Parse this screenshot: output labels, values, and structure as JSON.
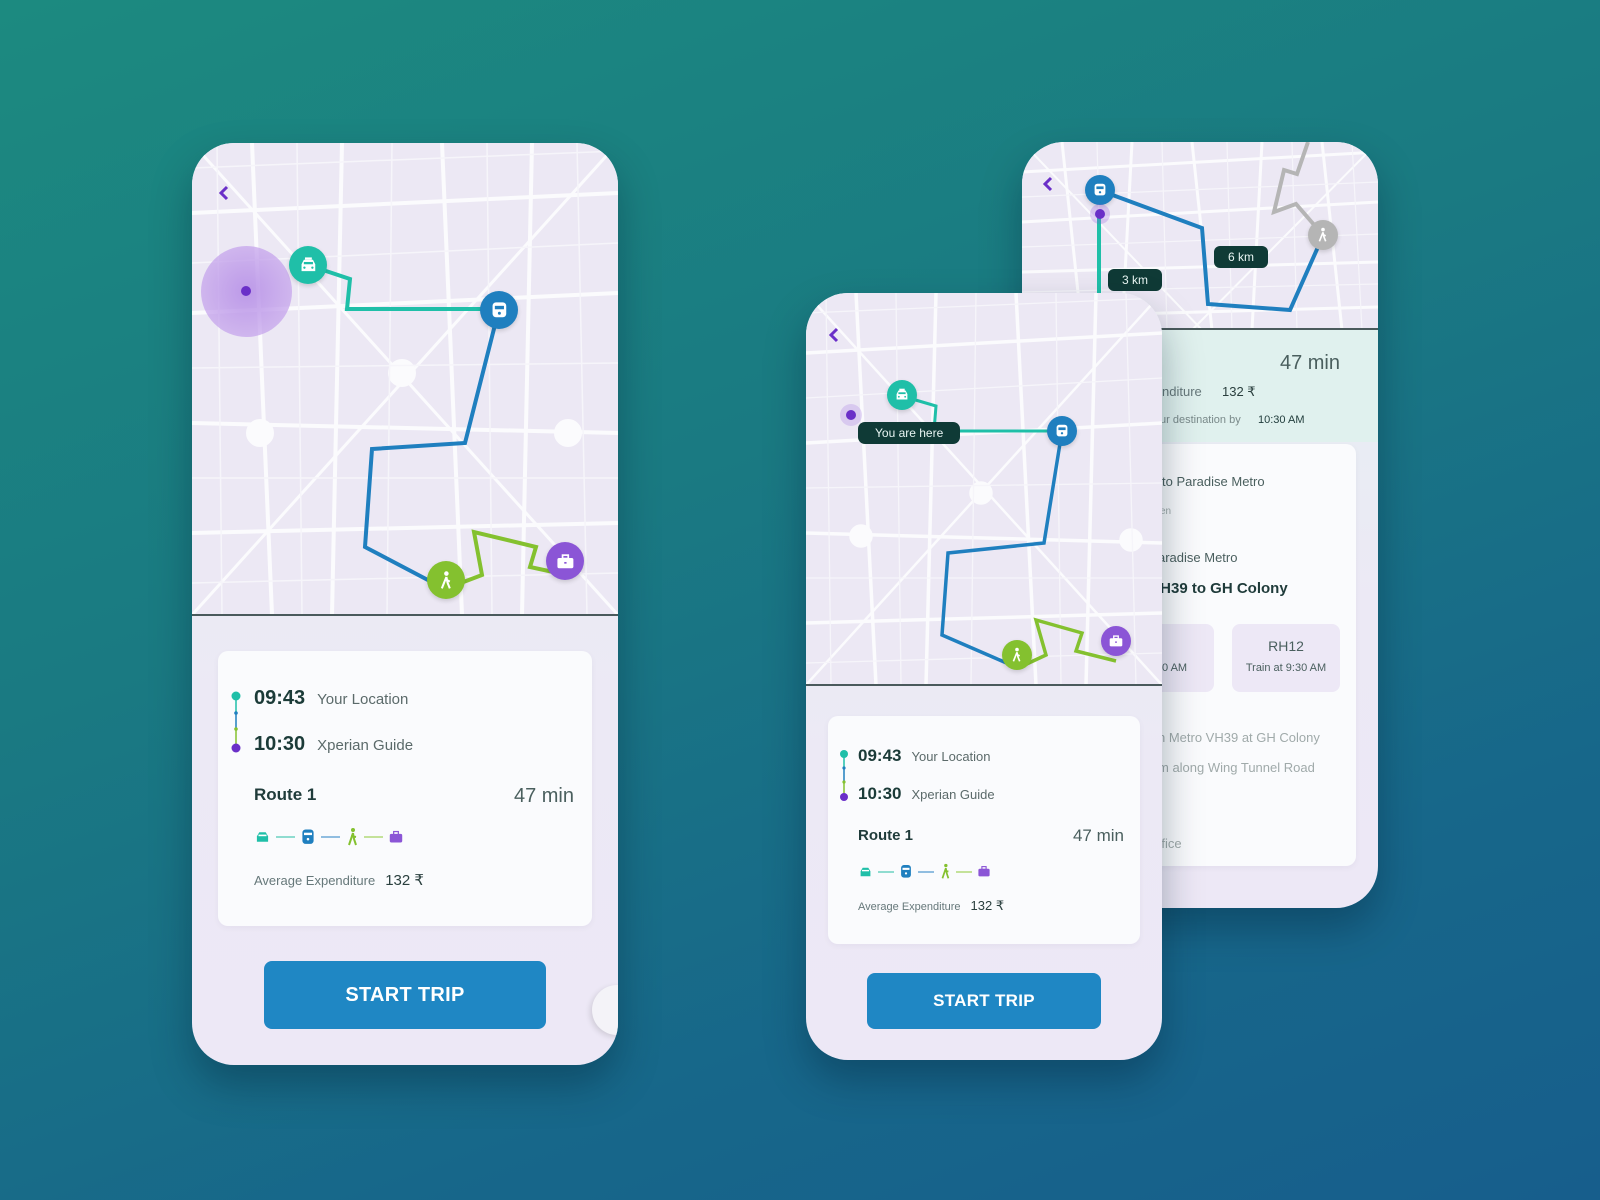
{
  "colors": {
    "taxi": "#1fbfa8",
    "metro": "#1f7fbf",
    "walk": "#84c12f",
    "office": "#8b55d6",
    "accent_purple": "#6a2fc8",
    "button": "#1f87c4",
    "tag_bg": "#0f3a36",
    "inactive": "#b5b5b5"
  },
  "screen_left": {
    "back_icon": "chevron-left",
    "map_nodes": [
      {
        "type": "taxi",
        "icon": "taxi-icon"
      },
      {
        "type": "metro",
        "icon": "train-icon"
      },
      {
        "type": "walk",
        "icon": "walk-icon"
      },
      {
        "type": "office",
        "icon": "briefcase-icon"
      }
    ],
    "summary": {
      "start_time": "09:43",
      "start_place": "Your Location",
      "end_time": "10:30",
      "end_place": "Xperian Guide",
      "route_label": "Route 1",
      "duration": "47 min",
      "expenditure_label": "Average Expenditure",
      "expenditure_value": "132 ₹"
    },
    "start_button": "START TRIP"
  },
  "screen_middle": {
    "back_icon": "chevron-left",
    "location_tag": "You are here",
    "summary": {
      "start_time": "09:43",
      "start_place": "Your Location",
      "end_time": "10:30",
      "end_place": "Xperian Guide",
      "route_label": "Route 1",
      "duration": "47 min",
      "expenditure_label": "Average Expenditure",
      "expenditure_value": "132 ₹"
    },
    "start_button": "START TRIP"
  },
  "screen_right": {
    "back_icon": "chevron-left",
    "distance_tags": [
      "3 km",
      "6 km"
    ],
    "duration": "47 min",
    "expenditure_label_partial": "nditure",
    "expenditure_value": "132 ₹",
    "arrival_label_partial": "ur destination by",
    "arrival_time": "10:30 AM",
    "steps": [
      {
        "title_partial": "to Paradise Metro",
        "sub_partial": "en"
      },
      {
        "title_partial": "aradise Metro",
        "heading_partial": "/H39 to GH Colony"
      }
    ],
    "trains": [
      {
        "code_partial": "",
        "time_partial": "0 AM"
      },
      {
        "code": "RH12",
        "time": "Train at 9:30 AM"
      }
    ],
    "instructions": [
      "n Metro VH39 at GH Colony",
      "m along Wing Tunnel Road"
    ],
    "destination_partial": "ffice"
  }
}
